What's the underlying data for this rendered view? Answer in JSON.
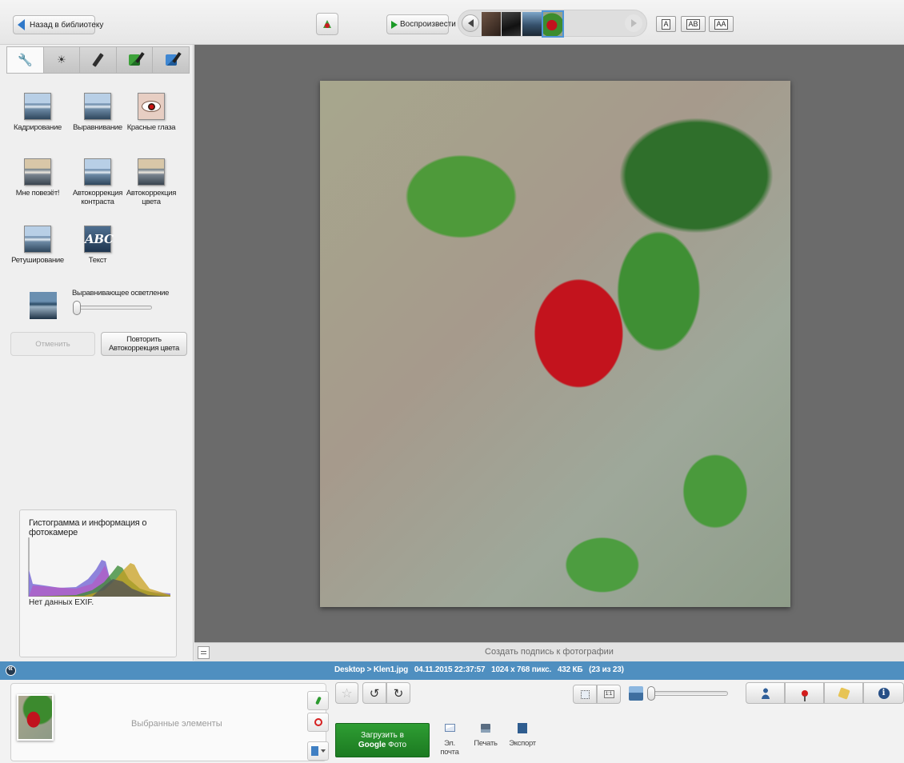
{
  "toolbar": {
    "back_label": "Назад в библиотеку",
    "play_label": "Воспроизвести",
    "text_modes": [
      "A",
      "AB",
      "AA"
    ]
  },
  "edit_panel": {
    "tools": {
      "crop": "Кадрирование",
      "straighten": "Выравнивание",
      "redeye": "Красные глаза",
      "lucky": "Мне повезёт!",
      "autocontrast": "Автокоррекция контраста",
      "autocolor": "Автокоррекция цвета",
      "retouch": "Ретуширование",
      "text": "Текст",
      "text_icon": "ABC"
    },
    "fill_light": {
      "label": "Выравнивающее осветление",
      "value": 0
    },
    "undo_label": "Отменить",
    "redo_label": "Повторить Автокоррекция цвета"
  },
  "histogram": {
    "title": "Гистограмма и информация о фотокамере",
    "exif": "Нет данных EXIF.",
    "colors": {
      "red": "#c8a020",
      "green": "#3f8d3a",
      "blue": "#7b6fd6",
      "purple": "#b25bc4",
      "gray": "#555555"
    }
  },
  "caption": {
    "placeholder": "Создать подпись к фотографии"
  },
  "info_bar": {
    "path": "Desktop > Klen1.jpg",
    "datetime": "04.11.2015 22:37:57",
    "dimensions": "1024 x 768 пикс.",
    "size": "432 КБ",
    "count": "(23 из 23)"
  },
  "tray": {
    "label": "Выбранные элементы"
  },
  "actions": {
    "upload_line1": "Загрузить в",
    "upload_line2_bold": "Google",
    "upload_line2_rest": " Фото",
    "email": "Эл. почта",
    "print": "Печать",
    "export": "Экспорт"
  },
  "zoom": {
    "value": 0
  },
  "icons": {
    "back": "arrow-left-icon",
    "play": "play-icon",
    "tabs": [
      "wrench-icon",
      "sun-icon",
      "brush-icon",
      "green-brush-icon",
      "blue-brush-icon"
    ],
    "star": "star-icon",
    "rotate_left": "rotate-left-icon",
    "rotate_right": "rotate-right-icon",
    "people": "person-icon",
    "places": "map-pin-icon",
    "tags": "tag-icon",
    "info": "info-icon"
  },
  "colors": {
    "info_bar": "#4f8fc0",
    "upload_button": "#2e9d33",
    "preview_background": "#6b6b6b"
  }
}
